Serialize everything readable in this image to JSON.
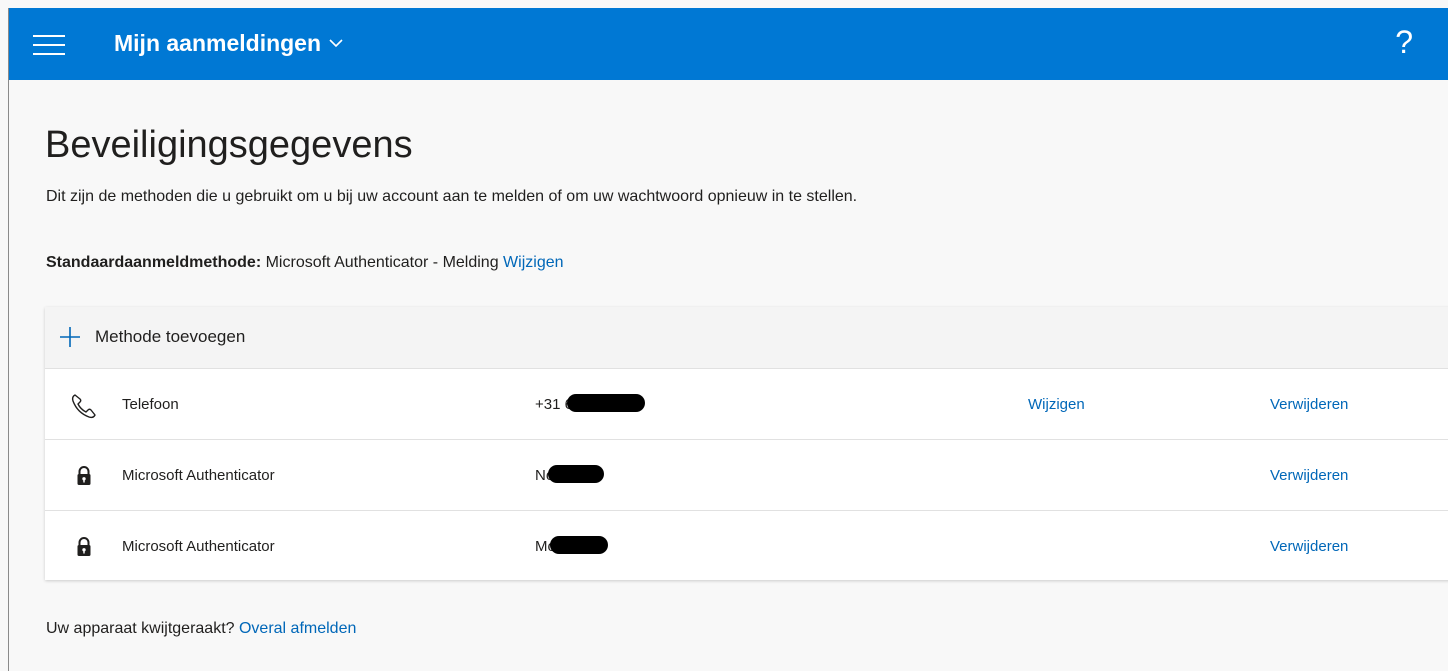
{
  "header": {
    "app_title": "Mijn aanmeldingen",
    "help_label": "?",
    "menu_icon": "hamburger-icon",
    "dropdown_icon": "chevron-down-icon",
    "brand_color": "#0078d4"
  },
  "page": {
    "title": "Beveiligingsgegevens",
    "subtitle": "Dit zijn de methoden die u gebruikt om u bij uw account aan te melden of om uw wachtwoord opnieuw in te stellen.",
    "default_method_label": "Standaardaanmeldmethode:",
    "default_method_value": " Microsoft Authenticator - Melding ",
    "default_method_change": "Wijzigen"
  },
  "methods": {
    "add_label": "Methode toevoegen",
    "add_icon": "plus-icon",
    "rows": [
      {
        "name": "Telefoon",
        "icon": "phone-icon",
        "detail_prefix": "+31 6",
        "change": "Wijzigen",
        "remove": "Verwijderen"
      },
      {
        "name": "Microsoft Authenticator",
        "icon": "lock-icon",
        "detail_prefix": "No",
        "remove": "Verwijderen"
      },
      {
        "name": "Microsoft Authenticator",
        "icon": "lock-icon",
        "detail_prefix": "Mo",
        "remove": "Verwijderen"
      }
    ]
  },
  "footer": {
    "lost_device_text": "Uw apparaat kwijtgeraakt? ",
    "sign_out_everywhere": "Overal afmelden"
  },
  "colors": {
    "link": "#0067b8",
    "background": "#f8f8f8"
  }
}
